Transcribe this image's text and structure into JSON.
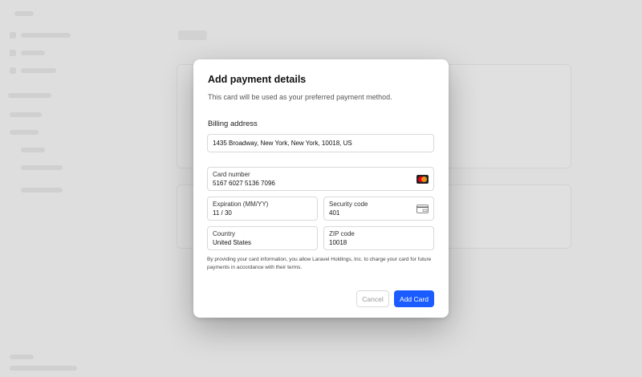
{
  "modal": {
    "title": "Add payment details",
    "subtitle": "This card will be used as your preferred payment method.",
    "billing_label": "Billing address",
    "address_value": "1435 Broadway, New York, New York, 10018, US",
    "card_number_label": "Card number",
    "card_number_value": "5167 6027 5136 7096",
    "card_brand_icon": "mastercard-icon",
    "expiration_label": "Expiration (MM/YY)",
    "expiration_value": "11 / 30",
    "security_label": "Security code",
    "security_value": "401",
    "security_icon": "card-cvc-icon",
    "country_label": "Country",
    "country_value": "United States",
    "zip_label": "ZIP code",
    "zip_value": "10018",
    "disclaimer": "By providing your card information, you allow Laravel Holdings, Inc. to charge your card for future payments in accordance with their terms.",
    "cancel_label": "Cancel",
    "add_label": "Add Card"
  },
  "colors": {
    "primary": "#1a5cff",
    "mastercard_red": "#eb001b",
    "mastercard_orange": "#f79e1b"
  }
}
